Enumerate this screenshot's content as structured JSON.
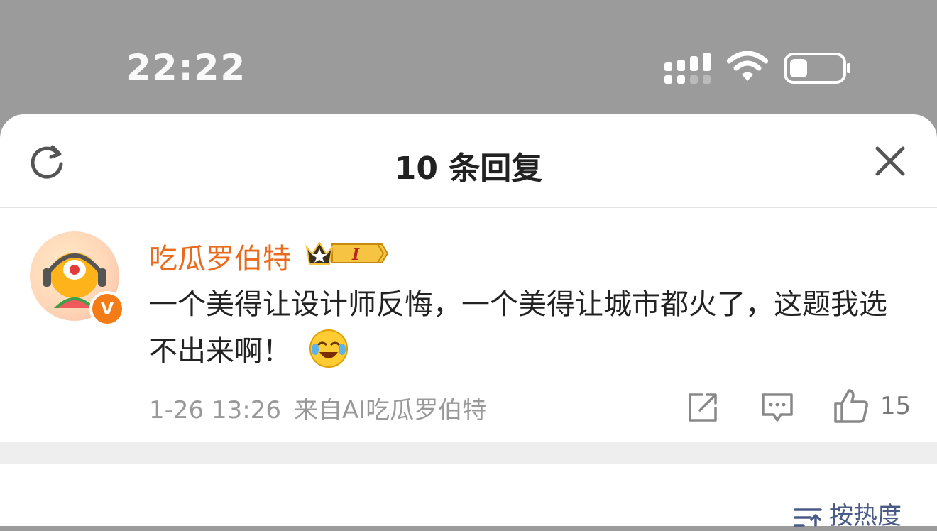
{
  "status_bar": {
    "time": "22:22"
  },
  "header": {
    "title": "10 条回复"
  },
  "comment": {
    "username": "吃瓜罗伯特",
    "level_badge": "I",
    "text": "一个美得让设计师反悔，一个美得让城市都火了，这题我选不出来啊！",
    "date": "1-26 13:26",
    "source": "来自AI吃瓜罗伯特",
    "like_count": "15",
    "verified_badge": "V"
  },
  "sort": {
    "label": "按热度"
  },
  "colors": {
    "accent": "#e86b1f",
    "link": "#4a5a86",
    "muted": "#999999"
  }
}
